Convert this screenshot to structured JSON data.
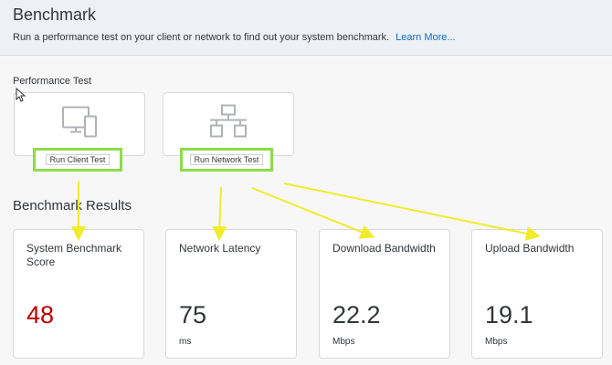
{
  "header": {
    "title": "Benchmark",
    "description": "Run a performance test on your client or network to find out your system benchmark.",
    "learn_more": "Learn More..."
  },
  "performance_test": {
    "label": "Performance Test",
    "client_button": "Run Client Test",
    "network_button": "Run Network Test",
    "client_icon": "computer-devices-icon",
    "network_icon": "network-icon"
  },
  "results": {
    "label": "Benchmark Results",
    "cards": [
      {
        "label": "System Benchmark Score",
        "value": "48",
        "unit": ""
      },
      {
        "label": "Network Latency",
        "value": "75",
        "unit": "ms"
      },
      {
        "label": "Download Bandwidth",
        "value": "22.2",
        "unit": "Mbps"
      },
      {
        "label": "Upload Bandwidth",
        "value": "19.1",
        "unit": "Mbps"
      }
    ]
  },
  "colors": {
    "score_value": "#bb0000",
    "highlight_border": "#8ddc4a",
    "arrow": "#f0ec2a",
    "link": "#0a6ed1"
  }
}
